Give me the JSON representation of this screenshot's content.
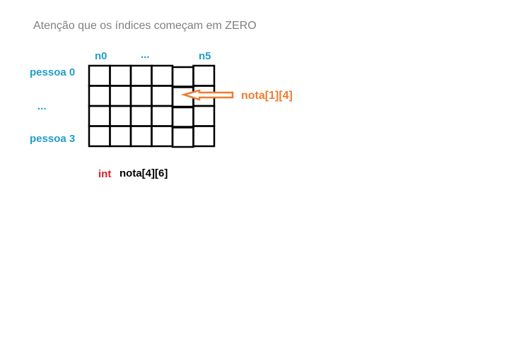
{
  "note": "Atenção que os índices começam em ZERO",
  "columns": {
    "first": "n0",
    "middle": "...",
    "last": "n5"
  },
  "rows": {
    "first": "pessoa 0",
    "middle": "...",
    "last": "pessoa 3"
  },
  "grid": {
    "rows": 4,
    "cols": 6,
    "highlighted": {
      "row": 1,
      "col": 4
    }
  },
  "pointer_label": "nota[1][4]",
  "declaration": {
    "type": "int",
    "name": "nota[4][6]"
  },
  "colors": {
    "label_blue": "#1f9ec8",
    "arrow_orange": "#ed7d31",
    "type_red": "#d81e26",
    "note_gray": "#808080"
  }
}
